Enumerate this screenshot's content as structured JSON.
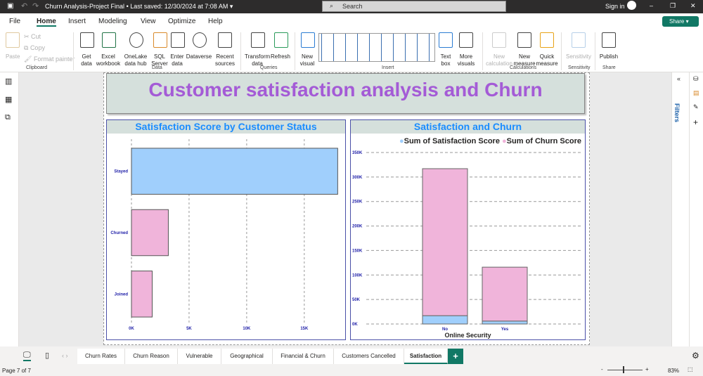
{
  "titlebar": {
    "title": "Churn Analysis-Project Final",
    "saved": "• Last saved: 12/30/2024 at 7:08 AM",
    "search": "Search",
    "sign_in": "Sign in"
  },
  "menu": [
    "File",
    "Home",
    "Insert",
    "Modeling",
    "View",
    "Optimize",
    "Help"
  ],
  "share": "Share",
  "ribbon": {
    "clipboard": {
      "paste": "Paste",
      "cut": "Cut",
      "copy": "Copy",
      "format_painter": "Format painter",
      "group": "Clipboard"
    },
    "data": {
      "items": [
        "Get data",
        "Excel workbook",
        "OneLake data hub",
        "SQL Server",
        "Enter data",
        "Dataverse",
        "Recent sources"
      ],
      "group": "Data"
    },
    "queries": {
      "items": [
        "Transform data",
        "Refresh"
      ],
      "group": "Queries"
    },
    "insert": {
      "items": [
        "New visual",
        "Text box",
        "More visuals"
      ],
      "group": "Insert"
    },
    "calculations": {
      "items": [
        "New calculation",
        "New measure",
        "Quick measure"
      ],
      "group": "Calculations"
    },
    "sensitivity": {
      "items": [
        "Sensitivity"
      ],
      "group": "Sensitivity"
    },
    "share": {
      "items": [
        "Publish"
      ],
      "group": "Share"
    }
  },
  "report_title": "Customer satisfaction analysis and Churn",
  "filters_label": "Filters",
  "chart_data": [
    {
      "type": "bar",
      "orientation": "horizontal",
      "title": "Satisfaction Score by Customer Status",
      "categories": [
        "Stayed",
        "Churned",
        "Joined"
      ],
      "values": [
        17900,
        3200,
        1800
      ],
      "xticks": [
        "0K",
        "5K",
        "10K",
        "15K"
      ],
      "xlim": [
        0,
        18000
      ],
      "grid": true,
      "colors": [
        "#a0cffc",
        "#f0b4da",
        "#f0b4da"
      ]
    },
    {
      "type": "bar",
      "stacked": true,
      "title": "Satisfaction and Churn",
      "xlabel": "Online Security",
      "categories": [
        "No",
        "Yes"
      ],
      "series": [
        {
          "name": "Sum of Satisfaction Score",
          "values": [
            17000,
            6000
          ],
          "color": "#a0cffc"
        },
        {
          "name": "Sum of Churn Score",
          "values": [
            300000,
            110000
          ],
          "color": "#f0b4da"
        }
      ],
      "yticks": [
        "0K",
        "50K",
        "100K",
        "150K",
        "200K",
        "250K",
        "300K",
        "350K"
      ],
      "ylim": [
        0,
        350000
      ],
      "grid": true,
      "legend": "top-right"
    }
  ],
  "tabs": [
    "Churn Rates",
    "Churn Reason",
    "Vulnerable",
    "Geographical",
    "Financial & Churn",
    "Customers Cancelled",
    "Satisfaction"
  ],
  "active_tab": "Satisfaction",
  "status": {
    "page": "Page 7 of 7",
    "zoom": "83%"
  }
}
